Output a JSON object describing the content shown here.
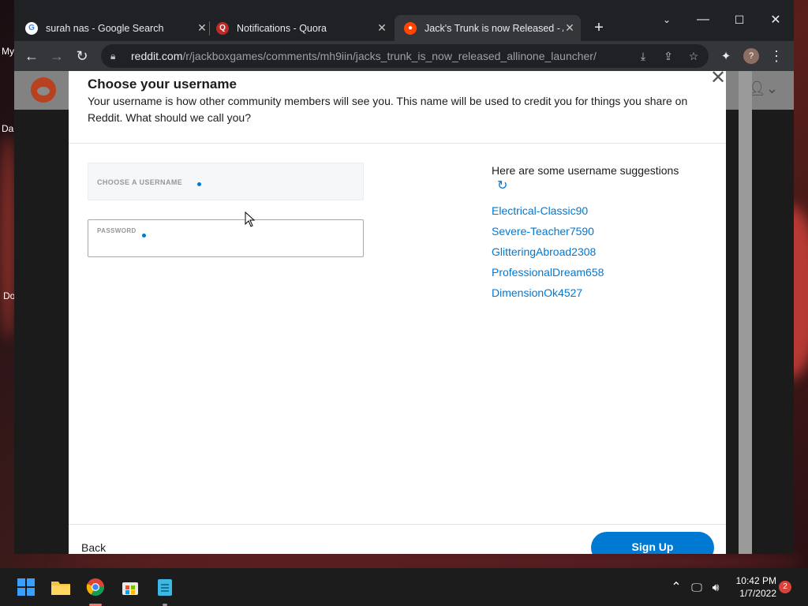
{
  "browser": {
    "tabs": [
      {
        "title": "surah nas - Google Search",
        "favicon": "google-icon",
        "active": false
      },
      {
        "title": "Notifications - Quora",
        "favicon": "quora-icon",
        "active": false
      },
      {
        "title": "Jack's Trunk is now Released - Al",
        "favicon": "reddit-icon",
        "active": true
      }
    ],
    "url_host": "reddit.com",
    "url_path": "/r/jackboxgames/comments/mh9iin/jacks_trunk_is_now_released_allinone_launcher/"
  },
  "desktop": {
    "labels": [
      "My",
      "Da",
      "Do"
    ]
  },
  "modal": {
    "title": "Choose your username",
    "description": "Your username is how other community members will see you. This name will be used to credit you for things you share on Reddit. What should we call you?",
    "username_label": "CHOOSE A USERNAME",
    "username_value": "",
    "password_label": "PASSWORD",
    "password_value": "",
    "suggestions_heading": "Here are some username suggestions",
    "suggestions": [
      "Electrical-Classic90",
      "Severe-Teacher7590",
      "GlitteringAbroad2308",
      "ProfessionalDream658",
      "DimensionOk4527"
    ],
    "back_label": "Back",
    "signup_label": "Sign Up"
  },
  "taskbar": {
    "time": "10:42 PM",
    "date": "1/7/2022",
    "notification_count": "2"
  },
  "colors": {
    "reddit_blue": "#0079d3",
    "chrome_dark": "#202124",
    "reddit_orange": "#ff4500"
  }
}
